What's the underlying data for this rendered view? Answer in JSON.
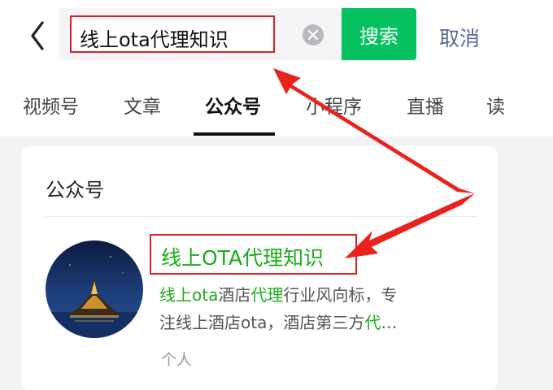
{
  "search": {
    "query": "线上ota代理知识",
    "button_label": "搜索",
    "cancel_label": "取消"
  },
  "tabs": [
    {
      "label": "视频号",
      "active": false
    },
    {
      "label": "文章",
      "active": false
    },
    {
      "label": "公众号",
      "active": true
    },
    {
      "label": "小程序",
      "active": false
    },
    {
      "label": "直播",
      "active": false
    },
    {
      "label": "读",
      "active": false
    }
  ],
  "section": {
    "title": "公众号"
  },
  "result": {
    "name": "线上OTA代理知识",
    "description_line1_parts": [
      "线上ota",
      "酒店",
      "代理",
      "行业风向标，专"
    ],
    "description_line2_parts": [
      "注线上酒店ota，酒店第三方",
      "代",
      "…"
    ],
    "type": "个人"
  },
  "colors": {
    "accent_green": "#07c160",
    "highlight_green": "#1aad19",
    "cancel_blue": "#576b95",
    "annotation_red": "#e02020"
  },
  "icons": {
    "back": "chevron-left-icon",
    "clear": "clear-circle-icon"
  }
}
